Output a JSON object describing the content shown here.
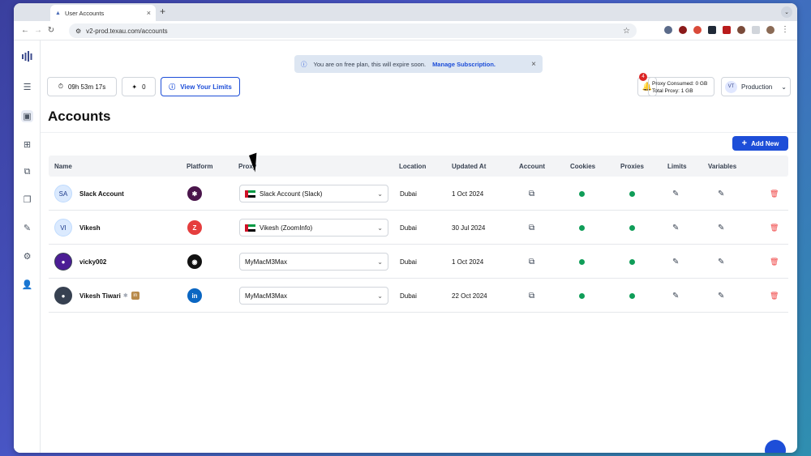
{
  "browser": {
    "tab_title": "User Accounts",
    "url": "v2-prod.texau.com/accounts"
  },
  "banner": {
    "text": "You are on free plan, this will expire soon.",
    "link": "Manage Subscription."
  },
  "toolbar": {
    "timer": "09h 53m 17s",
    "credits": "0",
    "limits_label": "View Your Limits",
    "notifications": "4",
    "proxy_consumed": "Proxy Consumed: 0 GB",
    "total_proxy": "Total Proxy: 1 GB",
    "env_initials": "VT",
    "env_label": "Production"
  },
  "page": {
    "title": "Accounts",
    "add_label": "Add New"
  },
  "table": {
    "headers": [
      "Name",
      "Platform",
      "Proxy",
      "Location",
      "Updated At",
      "Account",
      "Cookies",
      "Proxies",
      "Limits",
      "Variables"
    ],
    "rows": [
      {
        "initials": "SA",
        "name": "Slack Account",
        "platform": "slack",
        "proxy": "Slack Account (Slack)",
        "flag": true,
        "location": "Dubai",
        "updated": "1 Oct 2024"
      },
      {
        "initials": "VI",
        "name": "Vikesh",
        "platform": "zoominfo",
        "proxy": "Vikesh (ZoomInfo)",
        "flag": true,
        "location": "Dubai",
        "updated": "30 Jul 2024"
      },
      {
        "initials": "",
        "name": "vicky002",
        "platform": "github",
        "proxy": "MyMacM3Max",
        "flag": false,
        "location": "Dubai",
        "updated": "1 Oct 2024"
      },
      {
        "initials": "",
        "name": "Vikesh Tiwari",
        "platform": "linkedin",
        "proxy": "MyMacM3Max",
        "flag": false,
        "location": "Dubai",
        "updated": "22 Oct 2024"
      }
    ]
  },
  "colors": {
    "accent": "#1d4ed8",
    "status_green": "#0f9d58",
    "danger": "#ef4444"
  }
}
